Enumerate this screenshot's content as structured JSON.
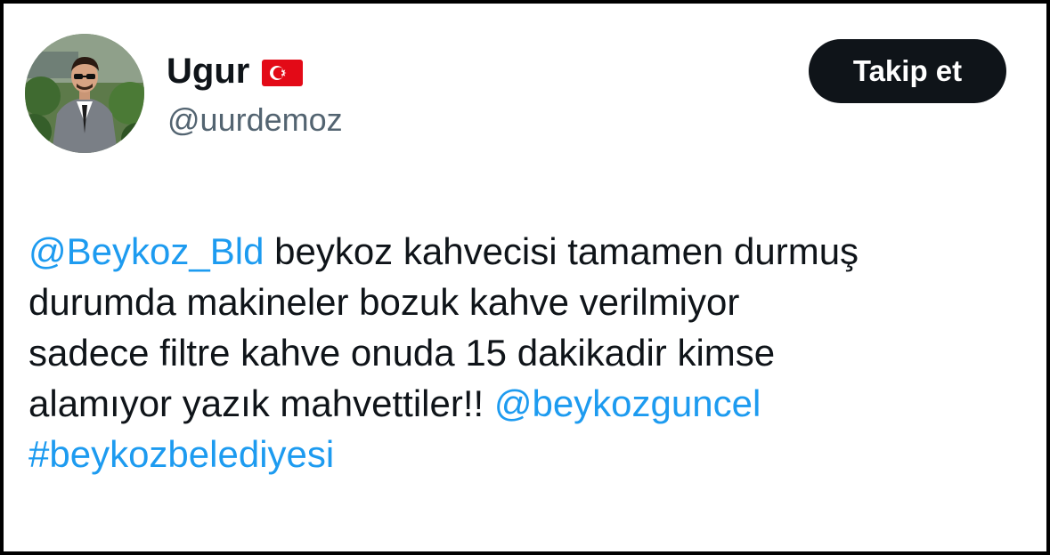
{
  "user": {
    "display_name": "Ugur",
    "flag_icon": "turkey-flag-icon",
    "handle": "@uurdemoz",
    "avatar_icon": "profile-photo"
  },
  "follow_button": {
    "label": "Takip et"
  },
  "tweet": {
    "segments": [
      {
        "type": "mention",
        "text": "@Beykoz_Bld"
      },
      {
        "type": "text",
        "text": " beykoz kahvecisi tamamen durmuş\ndurumda makineler bozuk kahve verilmiyor\nsadece filtre kahve onuda 15 dakikadir kimse\nalamıyor yazık mahvettiler!! "
      },
      {
        "type": "mention",
        "text": "@beykozguncel"
      },
      {
        "type": "text",
        "text": "\n"
      },
      {
        "type": "hashtag",
        "text": "#beykozbelediyesi"
      }
    ]
  },
  "colors": {
    "text": "#0f1419",
    "secondary": "#536471",
    "link": "#1d9bf0",
    "button_bg": "#0f1419",
    "flag_red": "#e30a17"
  }
}
